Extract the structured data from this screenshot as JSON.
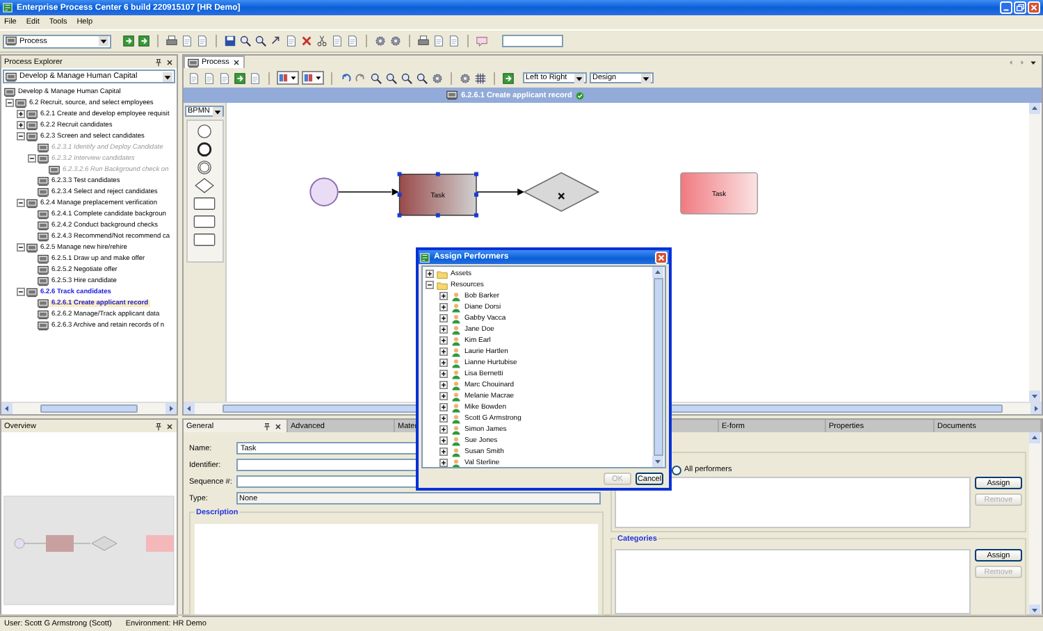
{
  "window": {
    "title": "Enterprise Process Center 6 build 220915107 [HR Demo]"
  },
  "menu": [
    "File",
    "Edit",
    "Tools",
    "Help"
  ],
  "toolbar": {
    "perspective": "Process"
  },
  "explorer": {
    "title": "Process Explorer",
    "model": "Develop & Manage Human Capital",
    "tree": [
      {
        "label": "Develop & Manage Human Capital",
        "selected": false,
        "disabled": false,
        "active": false,
        "children": [
          {
            "label": "6.2 Recruit, source, and select employees",
            "selected": false,
            "disabled": false,
            "active": false,
            "expanded": true,
            "children": [
              {
                "label": "6.2.1 Create and develop employee requisit",
                "selected": false,
                "disabled": false,
                "active": false,
                "expanded": false
              },
              {
                "label": "6.2.2 Recruit candidates",
                "selected": false,
                "disabled": false,
                "active": false,
                "expanded": false
              },
              {
                "label": "6.2.3 Screen and select candidates",
                "selected": false,
                "disabled": false,
                "active": false,
                "expanded": true,
                "children": [
                  {
                    "label": "6.2.3.1 Identify and Deploy Candidate",
                    "selected": false,
                    "disabled": true,
                    "active": false
                  },
                  {
                    "label": "6.2.3.2 Interview candidates",
                    "selected": false,
                    "disabled": true,
                    "active": false,
                    "expanded": true,
                    "children": [
                      {
                        "label": "6.2.3.2.6 Run Background check on",
                        "selected": false,
                        "disabled": true,
                        "active": false
                      }
                    ]
                  },
                  {
                    "label": "6.2.3.3 Test candidates",
                    "selected": false,
                    "disabled": false,
                    "active": false
                  },
                  {
                    "label": "6.2.3.4 Select and reject candidates",
                    "selected": false,
                    "disabled": false,
                    "active": false
                  }
                ]
              },
              {
                "label": "6.2.4 Manage preplacement verification",
                "selected": false,
                "disabled": false,
                "active": false,
                "expanded": true,
                "children": [
                  {
                    "label": "6.2.4.1 Complete candidate backgroun",
                    "selected": false,
                    "disabled": false,
                    "active": false
                  },
                  {
                    "label": "6.2.4.2 Conduct background checks",
                    "selected": false,
                    "disabled": false,
                    "active": false
                  },
                  {
                    "label": "6.2.4.3 Recommend/Not recommend ca",
                    "selected": false,
                    "disabled": false,
                    "active": false
                  }
                ]
              },
              {
                "label": "6.2.5 Manage new hire/rehire",
                "selected": false,
                "disabled": false,
                "active": false,
                "expanded": true,
                "children": [
                  {
                    "label": "6.2.5.1 Draw up and make offer",
                    "selected": false,
                    "disabled": false,
                    "active": false
                  },
                  {
                    "label": "6.2.5.2 Negotiate offer",
                    "selected": false,
                    "disabled": false,
                    "active": false
                  },
                  {
                    "label": "6.2.5.3 Hire candidate",
                    "selected": false,
                    "disabled": false,
                    "active": false
                  }
                ]
              },
              {
                "label": "6.2.6 Track candidates",
                "selected": false,
                "disabled": false,
                "active": true,
                "expanded": true,
                "children": [
                  {
                    "label": "6.2.6.1 Create applicant record",
                    "selected": true,
                    "disabled": false,
                    "active": true
                  },
                  {
                    "label": "6.2.6.2 Manage/Track applicant data",
                    "selected": false,
                    "disabled": false,
                    "active": false
                  },
                  {
                    "label": "6.2.6.3 Archive and retain records of n",
                    "selected": false,
                    "disabled": false,
                    "active": false
                  }
                ]
              }
            ]
          }
        ]
      }
    ]
  },
  "process_tab": {
    "label": "Process",
    "selected": true
  },
  "diagram": {
    "layout": "Left to Right",
    "mode": "Design",
    "title": "6.2.6.1 Create applicant record",
    "notation": "BPMN",
    "nodes": [
      {
        "kind": "start",
        "selected": false
      },
      {
        "kind": "task",
        "label": "Task",
        "selected": true
      },
      {
        "kind": "gateway",
        "selected": false
      },
      {
        "kind": "task",
        "label": "Task",
        "selected": false
      }
    ]
  },
  "overview": {
    "title": "Overview"
  },
  "properties": {
    "tabs": [
      {
        "label": "General",
        "selected": true
      },
      {
        "label": "Advanced",
        "selected": false
      },
      {
        "label": "Mater",
        "selected": false
      },
      {
        "label": "E-form",
        "selected": false
      },
      {
        "label": "Properties",
        "selected": false
      },
      {
        "label": "Documents",
        "selected": false
      }
    ],
    "fields": [
      {
        "label": "Name:",
        "kind": "text",
        "value": "Task"
      },
      {
        "label": "Identifier:",
        "kind": "text"
      },
      {
        "label": "Sequence #:",
        "kind": "text"
      },
      {
        "label": "Type:",
        "kind": "dropdown",
        "value": "None"
      }
    ],
    "description": {
      "title": "Description"
    },
    "performers": {
      "all_performers": {
        "label": "All performers",
        "checked": false
      },
      "buttons": [
        {
          "label": "Assign",
          "disabled": false
        },
        {
          "label": "Remove",
          "disabled": true
        }
      ]
    },
    "categories": {
      "title": "Categories",
      "buttons": [
        {
          "label": "Assign",
          "disabled": false
        },
        {
          "label": "Remove",
          "disabled": true
        }
      ]
    }
  },
  "dialog": {
    "title": "Assign Performers",
    "tree": [
      {
        "label": "Assets",
        "kind": "folder",
        "expanded": false
      },
      {
        "label": "Resources",
        "kind": "folder",
        "expanded": true,
        "children": [
          {
            "label": "Bob  Barker",
            "kind": "person",
            "expanded": false
          },
          {
            "label": "Diane Dorsi",
            "kind": "person",
            "expanded": false
          },
          {
            "label": "Gabby Vacca",
            "kind": "person",
            "expanded": false
          },
          {
            "label": "Jane Doe",
            "kind": "person",
            "expanded": false
          },
          {
            "label": "Kim Earl",
            "kind": "person",
            "expanded": false
          },
          {
            "label": "Laurie Hartlen",
            "kind": "person",
            "expanded": false
          },
          {
            "label": "Lianne  Hurtubise",
            "kind": "person",
            "expanded": false
          },
          {
            "label": "Lisa Bernetti",
            "kind": "person",
            "expanded": false
          },
          {
            "label": "Marc Chouinard",
            "kind": "person",
            "expanded": false
          },
          {
            "label": "Melanie Macrae",
            "kind": "person",
            "expanded": false
          },
          {
            "label": "Mike  Bowden",
            "kind": "person",
            "expanded": false
          },
          {
            "label": "Scott G Armstrong",
            "kind": "person",
            "expanded": false
          },
          {
            "label": "Simon  James",
            "kind": "person",
            "expanded": false
          },
          {
            "label": "Sue  Jones",
            "kind": "person",
            "expanded": false
          },
          {
            "label": "Susan  Smith",
            "kind": "person",
            "expanded": false
          },
          {
            "label": "Val Sterline",
            "kind": "person",
            "expanded": false
          }
        ]
      }
    ],
    "buttons": [
      {
        "label": "OK",
        "disabled": true
      },
      {
        "label": "Cancel",
        "disabled": false
      }
    ]
  },
  "status_bar": [
    "User: Scott G Armstrong (Scott)",
    "Environment: HR Demo"
  ]
}
